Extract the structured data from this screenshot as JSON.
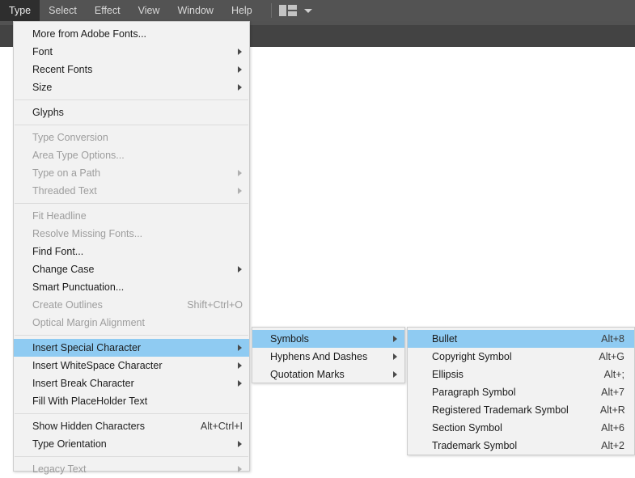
{
  "menubar": {
    "items": [
      {
        "label": "Type",
        "active": true
      },
      {
        "label": "Select",
        "active": false
      },
      {
        "label": "Effect",
        "active": false
      },
      {
        "label": "View",
        "active": false
      },
      {
        "label": "Window",
        "active": false
      },
      {
        "label": "Help",
        "active": false
      }
    ],
    "arrange_icon": "arrange-documents-icon",
    "chevron_icon": "chevron-down-icon"
  },
  "colors": {
    "menubar_bg": "#535353",
    "menubar_active_bg": "#2e2e2e",
    "toolbar_bg": "#434343",
    "menu_bg": "#f2f2f2",
    "menu_border": "#cdcdcd",
    "highlight": "#8fcbf2",
    "text": "#1b1b1b",
    "text_disabled": "#9d9d9d",
    "canvas_bg": "#ffffff"
  },
  "type_menu": {
    "name": "Type",
    "groups": [
      {
        "items": [
          {
            "label": "More from Adobe Fonts...",
            "accel": "",
            "submenu": false,
            "disabled": false,
            "highlight": false
          },
          {
            "label": "Font",
            "accel": "",
            "submenu": true,
            "disabled": false,
            "highlight": false
          },
          {
            "label": "Recent Fonts",
            "accel": "",
            "submenu": true,
            "disabled": false,
            "highlight": false
          },
          {
            "label": "Size",
            "accel": "",
            "submenu": true,
            "disabled": false,
            "highlight": false
          }
        ]
      },
      {
        "items": [
          {
            "label": "Glyphs",
            "accel": "",
            "submenu": false,
            "disabled": false,
            "highlight": false
          }
        ]
      },
      {
        "items": [
          {
            "label": "Type Conversion",
            "accel": "",
            "submenu": false,
            "disabled": true,
            "highlight": false
          },
          {
            "label": "Area Type Options...",
            "accel": "",
            "submenu": false,
            "disabled": true,
            "highlight": false
          },
          {
            "label": "Type on a Path",
            "accel": "",
            "submenu": true,
            "disabled": true,
            "highlight": false
          },
          {
            "label": "Threaded Text",
            "accel": "",
            "submenu": true,
            "disabled": true,
            "highlight": false
          }
        ]
      },
      {
        "items": [
          {
            "label": "Fit Headline",
            "accel": "",
            "submenu": false,
            "disabled": true,
            "highlight": false
          },
          {
            "label": "Resolve Missing Fonts...",
            "accel": "",
            "submenu": false,
            "disabled": true,
            "highlight": false
          },
          {
            "label": "Find Font...",
            "accel": "",
            "submenu": false,
            "disabled": false,
            "highlight": false
          },
          {
            "label": "Change Case",
            "accel": "",
            "submenu": true,
            "disabled": false,
            "highlight": false
          },
          {
            "label": "Smart Punctuation...",
            "accel": "",
            "submenu": false,
            "disabled": false,
            "highlight": false
          },
          {
            "label": "Create Outlines",
            "accel": "Shift+Ctrl+O",
            "submenu": false,
            "disabled": true,
            "highlight": false
          },
          {
            "label": "Optical Margin Alignment",
            "accel": "",
            "submenu": false,
            "disabled": true,
            "highlight": false
          }
        ]
      },
      {
        "items": [
          {
            "label": "Insert Special Character",
            "accel": "",
            "submenu": true,
            "disabled": false,
            "highlight": true
          },
          {
            "label": "Insert WhiteSpace Character",
            "accel": "",
            "submenu": true,
            "disabled": false,
            "highlight": false
          },
          {
            "label": "Insert Break Character",
            "accel": "",
            "submenu": true,
            "disabled": false,
            "highlight": false
          },
          {
            "label": "Fill With PlaceHolder Text",
            "accel": "",
            "submenu": false,
            "disabled": false,
            "highlight": false
          }
        ]
      },
      {
        "items": [
          {
            "label": "Show Hidden Characters",
            "accel": "Alt+Ctrl+I",
            "submenu": false,
            "disabled": false,
            "highlight": false
          },
          {
            "label": "Type Orientation",
            "accel": "",
            "submenu": true,
            "disabled": false,
            "highlight": false
          }
        ]
      },
      {
        "items": [
          {
            "label": "Legacy Text",
            "accel": "",
            "submenu": true,
            "disabled": true,
            "highlight": false
          }
        ]
      }
    ]
  },
  "insert_special_menu": {
    "name": "Insert Special Character",
    "items": [
      {
        "label": "Symbols",
        "accel": "",
        "submenu": true,
        "disabled": false,
        "highlight": true
      },
      {
        "label": "Hyphens And Dashes",
        "accel": "",
        "submenu": true,
        "disabled": false,
        "highlight": false
      },
      {
        "label": "Quotation Marks",
        "accel": "",
        "submenu": true,
        "disabled": false,
        "highlight": false
      }
    ]
  },
  "symbols_menu": {
    "name": "Symbols",
    "items": [
      {
        "label": "Bullet",
        "accel": "Alt+8",
        "submenu": false,
        "disabled": false,
        "highlight": true
      },
      {
        "label": "Copyright Symbol",
        "accel": "Alt+G",
        "submenu": false,
        "disabled": false,
        "highlight": false
      },
      {
        "label": "Ellipsis",
        "accel": "Alt+;",
        "submenu": false,
        "disabled": false,
        "highlight": false
      },
      {
        "label": "Paragraph Symbol",
        "accel": "Alt+7",
        "submenu": false,
        "disabled": false,
        "highlight": false
      },
      {
        "label": "Registered Trademark Symbol",
        "accel": "Alt+R",
        "submenu": false,
        "disabled": false,
        "highlight": false
      },
      {
        "label": "Section Symbol",
        "accel": "Alt+6",
        "submenu": false,
        "disabled": false,
        "highlight": false
      },
      {
        "label": "Trademark Symbol",
        "accel": "Alt+2",
        "submenu": false,
        "disabled": false,
        "highlight": false
      }
    ]
  }
}
